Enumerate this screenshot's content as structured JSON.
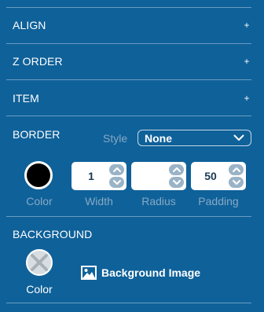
{
  "sections": {
    "align": {
      "label": "ALIGN",
      "toggle": "+"
    },
    "z_order": {
      "label": "Z ORDER",
      "toggle": "+"
    },
    "item": {
      "label": "ITEM",
      "toggle": "+"
    }
  },
  "border": {
    "title": "BORDER",
    "style_label": "Style",
    "style_value": "None",
    "color_label": "Color",
    "color_value": "#000000",
    "width": {
      "value": "1",
      "label": "Width"
    },
    "radius": {
      "value": "",
      "label": "Radius"
    },
    "padding": {
      "value": "50",
      "label": "Padding"
    }
  },
  "background": {
    "title": "BACKGROUND",
    "color_label": "Color",
    "image_label": "Background Image"
  },
  "theme": {
    "panel_bg": "#0f6199",
    "muted_text": "#86a9c5",
    "spinner": "#9ab3c7"
  },
  "icons": {
    "expand": "plus-icon",
    "select": "chevron-down-icon",
    "spinner_up": "chevron-up-icon",
    "spinner_down": "chevron-down-icon",
    "no_color": "no-color-icon",
    "image": "image-icon"
  }
}
